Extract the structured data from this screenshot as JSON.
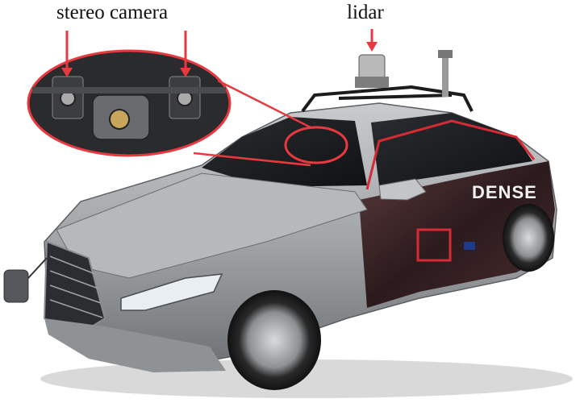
{
  "annotations": {
    "stereo_camera_label": "stereo camera",
    "lidar_label": "lidar"
  },
  "vehicle": {
    "door_brand": "DENSE"
  },
  "colors": {
    "arrow": "#e8393f",
    "car_body": "#a9acaf",
    "wrap_dark": "#3a2426",
    "accent_red": "#d62b34"
  }
}
